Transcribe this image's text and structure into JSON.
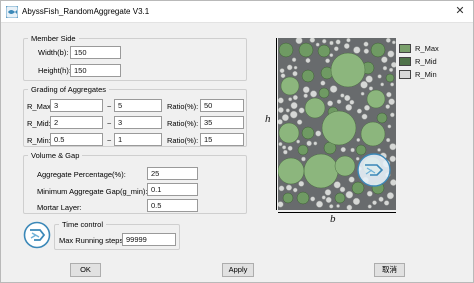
{
  "window": {
    "title": "AbyssFish_RandomAggregate V3.1",
    "close_glyph": "✕"
  },
  "member_side": {
    "legend": "Member Side",
    "width_label": "Width(b):",
    "width_value": "150",
    "height_label": "Height(h):",
    "height_value": "150"
  },
  "grading": {
    "legend": "Grading of Aggregates",
    "separator": "~",
    "rows": [
      {
        "label": "R_Max:",
        "min": "3",
        "max": "5",
        "ratio_label": "Ratio(%):",
        "ratio": "50"
      },
      {
        "label": "R_Mid:",
        "min": "2",
        "max": "3",
        "ratio_label": "Ratio(%):",
        "ratio": "35"
      },
      {
        "label": "R_Min:",
        "min": "0.5",
        "max": "1",
        "ratio_label": "Ratio(%):",
        "ratio": "15"
      }
    ]
  },
  "volume_gap": {
    "legend": "Volume & Gap",
    "aggregate_pct_label": "Aggregate Percentage(%):",
    "aggregate_pct_value": "25",
    "min_gap_label": "Minimum Aggregate Gap(g_min):",
    "min_gap_value": "0.1",
    "mortar_label": "Mortar Layer:",
    "mortar_value": "0.5"
  },
  "time_control": {
    "legend": "Time control",
    "max_steps_label": "Max Running steps:",
    "max_steps_value": "99999"
  },
  "figure": {
    "h_label": "h",
    "b_label": "b",
    "legend": [
      {
        "label": "R_Max",
        "color": "#7aa06c"
      },
      {
        "label": "R_Mid",
        "color": "#4f7349"
      },
      {
        "label": "R_Min",
        "color": "#d8d8d8"
      }
    ],
    "colors": {
      "background": "#686b6d",
      "large": "#8cb67d",
      "mid": "#6f9a63",
      "small": "#d6d8d6",
      "logo": "#3b88b8"
    }
  },
  "buttons": {
    "ok": "OK",
    "apply": "Apply",
    "cancel": "取消"
  }
}
